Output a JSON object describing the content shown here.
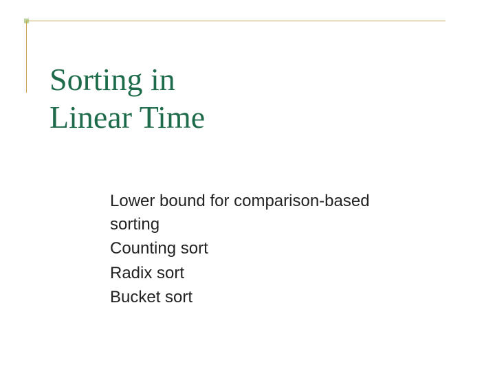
{
  "title": {
    "line1": "Sorting in",
    "line2": "Linear Time"
  },
  "subtitles": {
    "item1": "Lower bound for comparison-based sorting",
    "item2": "Counting sort",
    "item3": "Radix sort",
    "item4": "Bucket sort"
  }
}
